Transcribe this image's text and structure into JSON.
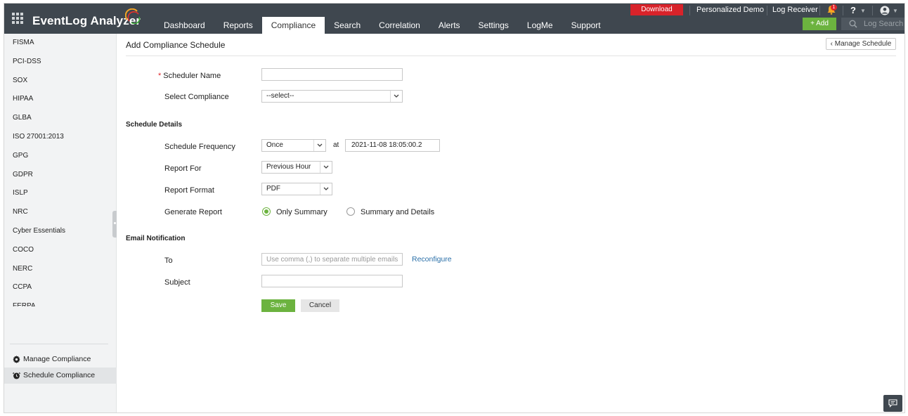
{
  "app": {
    "brand": "EventLog Analyzer",
    "nav_tabs": [
      {
        "label": "Dashboard"
      },
      {
        "label": "Reports"
      },
      {
        "label": "Compliance",
        "active": true
      },
      {
        "label": "Search"
      },
      {
        "label": "Correlation"
      },
      {
        "label": "Alerts"
      },
      {
        "label": "Settings"
      },
      {
        "label": "LogMe"
      },
      {
        "label": "Support"
      }
    ],
    "download_label": "Download",
    "personalized_demo": "Personalized Demo",
    "log_receiver": "Log Receiver",
    "notification_count": "1",
    "help_label": "?",
    "add_label": "+ Add",
    "log_search_label": "Log Search",
    "icons": {
      "apps": "grid-icon",
      "notifications": "bell-icon",
      "account": "user-icon",
      "search": "search-icon"
    },
    "colors": {
      "topbar": "#3f474f",
      "accent_green": "#6cb33f",
      "download_red": "#d8232a",
      "link_blue": "#2a6fa8"
    }
  },
  "sidebar": {
    "items": [
      {
        "label": "FISMA"
      },
      {
        "label": "PCI-DSS"
      },
      {
        "label": "SOX"
      },
      {
        "label": "HIPAA"
      },
      {
        "label": "GLBA"
      },
      {
        "label": "ISO 27001:2013"
      },
      {
        "label": "GPG"
      },
      {
        "label": "GDPR"
      },
      {
        "label": "ISLP"
      },
      {
        "label": "NRC"
      },
      {
        "label": "Cyber Essentials"
      },
      {
        "label": "COCO"
      },
      {
        "label": "NERC"
      },
      {
        "label": "CCPA"
      },
      {
        "label": "FERPA"
      }
    ],
    "manage_compliance": "Manage Compliance",
    "schedule_compliance": "Schedule Compliance"
  },
  "page": {
    "title": "Add Compliance Schedule",
    "manage_schedule_label": "Manage Schedule"
  },
  "form": {
    "scheduler_name": {
      "required_mark": "*",
      "label": "Scheduler Name",
      "value": ""
    },
    "select_compliance": {
      "label": "Select Compliance",
      "value": "--select--"
    },
    "schedule_details_heading": "Schedule Details",
    "schedule_frequency": {
      "label": "Schedule Frequency",
      "value": "Once",
      "at_label": "at",
      "datetime": "2021-11-08 18:05:00.2"
    },
    "report_for": {
      "label": "Report For",
      "value": "Previous Hour"
    },
    "report_format": {
      "label": "Report Format",
      "value": "PDF"
    },
    "generate_report": {
      "label": "Generate Report",
      "options": [
        {
          "label": "Only Summary",
          "selected": true
        },
        {
          "label": "Summary and Details",
          "selected": false
        }
      ]
    },
    "email_heading": "Email Notification",
    "to": {
      "label": "To",
      "placeholder": "Use comma (,) to separate multiple emails",
      "value": "",
      "reconfigure": "Reconfigure"
    },
    "subject": {
      "label": "Subject",
      "value": ""
    },
    "save_label": "Save",
    "cancel_label": "Cancel"
  }
}
